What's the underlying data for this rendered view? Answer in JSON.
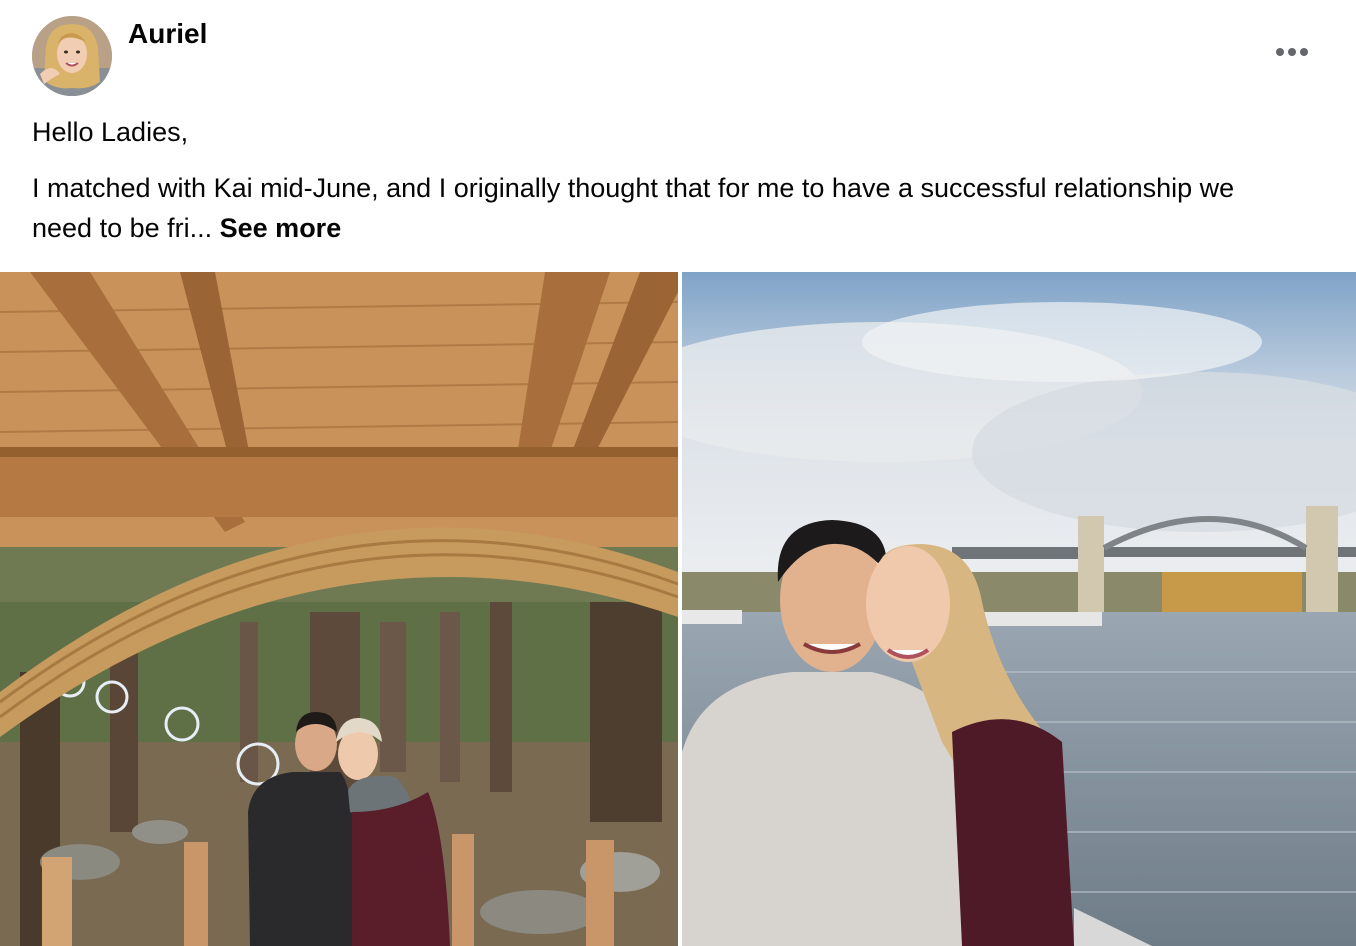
{
  "post": {
    "author": "Auriel",
    "greeting": "Hello Ladies,",
    "body_preview": "I matched with Kai mid-June, and I originally thought that for me to have a successful relationship we need to be fri...",
    "see_more_label": "See more"
  },
  "photos": [
    {
      "description": "couple-under-wooden-pavilion-forest"
    },
    {
      "description": "couple-by-water-with-bridge"
    }
  ],
  "icons": {
    "more": "more-options-icon"
  },
  "colors": {
    "text": "#050505",
    "icon": "#65676b",
    "background": "#ffffff"
  }
}
